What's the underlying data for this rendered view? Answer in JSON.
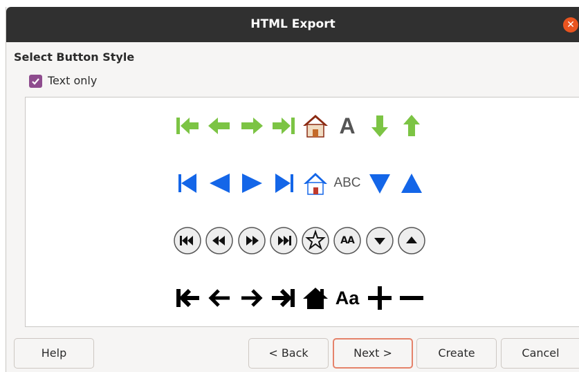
{
  "window": {
    "title": "HTML Export"
  },
  "section": {
    "title": "Select Button Style",
    "text_only_label": "Text only",
    "text_only_checked": true
  },
  "styles": {
    "green_arrows": {
      "icons": [
        "first-page-icon",
        "previous-page-icon",
        "next-page-icon",
        "last-page-icon",
        "home-icon",
        "text-icon",
        "move-down-icon",
        "move-up-icon"
      ],
      "text_glyph": "A",
      "colors": {
        "arrow": "#7cc444",
        "text": "#555555",
        "home_roof": "#8b2a12"
      }
    },
    "blue_triangles": {
      "icons": [
        "first-page-icon",
        "previous-page-icon",
        "next-page-icon",
        "last-page-icon",
        "home-icon",
        "text-icon",
        "move-down-icon",
        "move-up-icon"
      ],
      "text_glyph": "ABC",
      "colors": {
        "arrow": "#1466e8",
        "text": "#555555"
      }
    },
    "round_buttons": {
      "icons": [
        "first-page-icon",
        "previous-page-icon",
        "next-page-icon",
        "last-page-icon",
        "star-icon",
        "text-icon",
        "move-down-icon",
        "move-up-icon"
      ],
      "text_glyph": "AA",
      "colors": {
        "button": "#eeeeee",
        "glyph": "#111111"
      }
    },
    "black_arrows": {
      "icons": [
        "first-page-icon",
        "previous-page-icon",
        "next-page-icon",
        "last-page-icon",
        "home-icon",
        "text-icon",
        "plus-icon",
        "minus-icon"
      ],
      "text_glyph": "Aa",
      "colors": {
        "glyph": "#000000"
      }
    }
  },
  "buttons": {
    "help": "Help",
    "back": "< Back",
    "next": "Next >",
    "create": "Create",
    "cancel": "Cancel"
  }
}
